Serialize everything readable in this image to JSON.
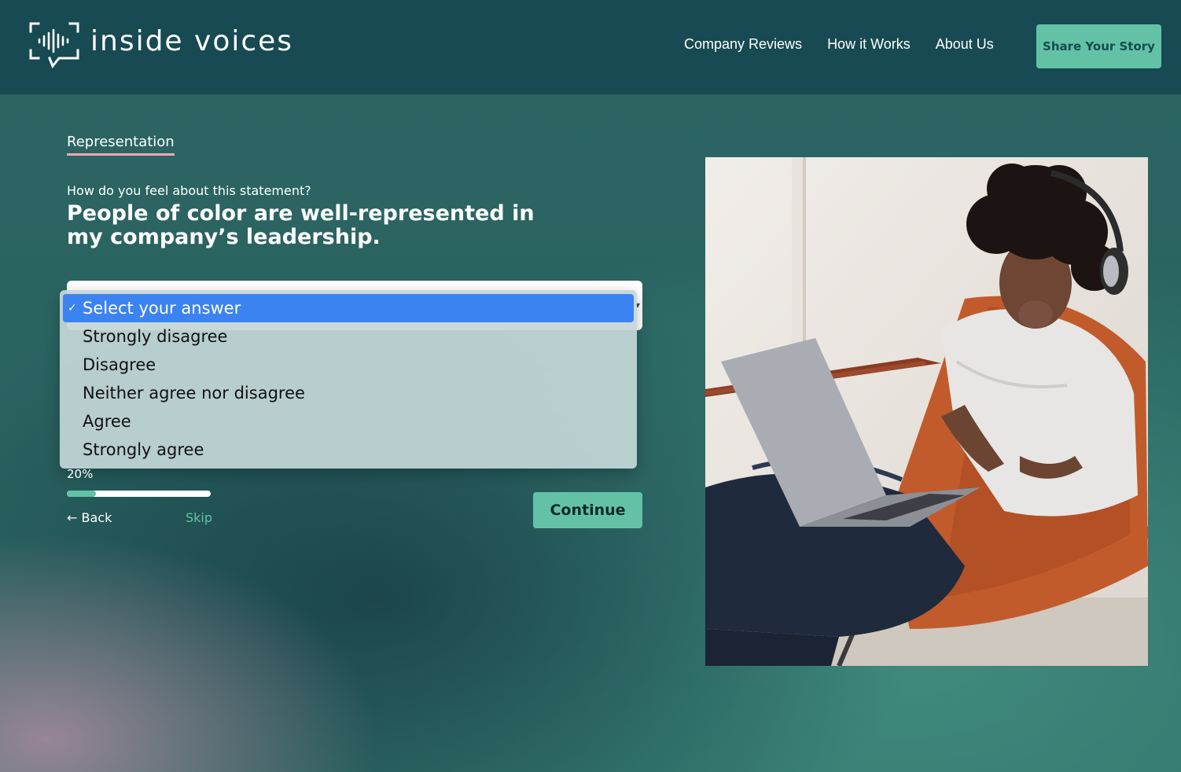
{
  "brand": {
    "name": "inside voices",
    "accent": "#63c2a6",
    "header_bg": "#174a52",
    "underline": "#f3a4b8"
  },
  "nav": {
    "links": [
      {
        "label": "Company Reviews"
      },
      {
        "label": "How it Works"
      },
      {
        "label": "About Us"
      }
    ],
    "cta_label": "Share Your Story"
  },
  "survey": {
    "section": "Representation",
    "intro": "How do you feel about this statement?",
    "statement": "People of color are well-represented in my company’s leadership.",
    "options": [
      "Select your answer",
      "Strongly disagree",
      "Disagree",
      "Neither agree nor disagree",
      "Agree",
      "Strongly agree"
    ],
    "selected_index": 0,
    "progress_label": "20%",
    "progress_fraction": 0.2,
    "back_label": "Back",
    "skip_label": "Skip",
    "continue_label": "Continue"
  },
  "icons": {
    "logo": "soundwave-speech-bubble-icon",
    "check": "✓",
    "back_arrow": "←",
    "chevron": "▾"
  }
}
